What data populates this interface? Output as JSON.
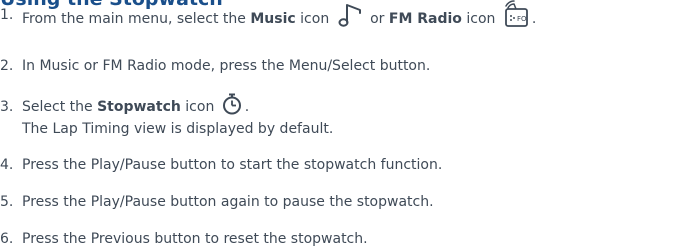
{
  "heading": "Using the Stopwatch",
  "steps": [
    {
      "num": "1.",
      "parts": {
        "a": "From the main menu, select the",
        "b": "Music",
        "c": "icon",
        "d": "or",
        "e": "FM Radio",
        "f": "icon",
        "g": "."
      },
      "icons": [
        "music-note-icon",
        "fm-radio-icon"
      ]
    },
    {
      "num": "2.",
      "text": "In Music or FM Radio mode, press the Menu/Select button."
    },
    {
      "num": "3.",
      "parts": {
        "a": "Select the",
        "b": "Stopwatch",
        "c": "icon",
        "d": "."
      },
      "sub": "The Lap Timing view is displayed by default.",
      "icons": [
        "stopwatch-icon"
      ]
    },
    {
      "num": "4.",
      "text": "Press the Play/Pause button to start the stopwatch function."
    },
    {
      "num": "5.",
      "text": "Press the Play/Pause button again to pause the stopwatch."
    },
    {
      "num": "6.",
      "text": "Press the Previous button to reset the stopwatch."
    }
  ],
  "colors": {
    "heading": "#1a4f8b",
    "body_text": "#3f4a57"
  }
}
